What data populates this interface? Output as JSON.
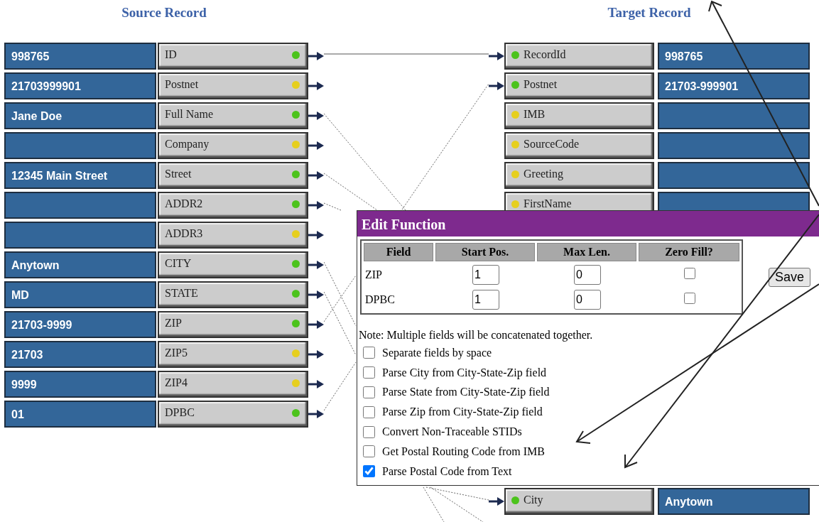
{
  "source": {
    "title": "Source Record",
    "rows": [
      {
        "value": "998765",
        "field": "ID",
        "color": "#4cc31c"
      },
      {
        "value": "21703999901",
        "field": "Postnet",
        "color": "#e6cf1e"
      },
      {
        "value": "Jane Doe",
        "field": "Full Name",
        "color": "#4cc31c"
      },
      {
        "field": "Company",
        "color": "#e6cf1e"
      },
      {
        "value": "12345 Main Street",
        "field": "Street",
        "color": "#4cc31c"
      },
      {
        "field": "ADDR2",
        "color": "#4cc31c"
      },
      {
        "field": "ADDR3",
        "color": "#e6cf1e"
      },
      {
        "value": "Anytown",
        "field": "CITY",
        "color": "#4cc31c"
      },
      {
        "value": "MD",
        "field": "STATE",
        "color": "#4cc31c"
      },
      {
        "value": "21703-9999",
        "field": "ZIP",
        "color": "#4cc31c"
      },
      {
        "value": "21703",
        "field": "ZIP5",
        "color": "#e6cf1e"
      },
      {
        "value": "9999",
        "field": "ZIP4",
        "color": "#e6cf1e"
      },
      {
        "value": "01",
        "field": "DPBC",
        "color": "#4cc31c"
      }
    ]
  },
  "target": {
    "title": "Target Record",
    "rows": [
      {
        "field": "RecordId",
        "value": "998765",
        "color": "#4cc31c",
        "mapped": true
      },
      {
        "field": "Postnet",
        "value": "21703-999901",
        "color": "#4cc31c",
        "mapped": true
      },
      {
        "field": "IMB",
        "color": "#e6cf1e",
        "mapped": false
      },
      {
        "field": "SourceCode",
        "color": "#e6cf1e",
        "mapped": false
      },
      {
        "field": "Greeting",
        "color": "#e6cf1e",
        "mapped": false
      },
      {
        "field": "FirstName",
        "color": "#e6cf1e",
        "mapped": false
      },
      {
        "field": "City",
        "value": "Anytown",
        "color": "#4cc31c",
        "mapped": true
      }
    ]
  },
  "dialog": {
    "title": "Edit Function",
    "columns": [
      "Field",
      "Start Pos.",
      "Max Len.",
      "Zero Fill?"
    ],
    "rows": [
      {
        "field": "ZIP",
        "start": "1",
        "max_len": "0",
        "zero_fill": false
      },
      {
        "field": "DPBC",
        "start": "1",
        "max_len": "0",
        "zero_fill": false
      }
    ],
    "save": "Save",
    "note": "Note: Multiple fields will be concatenated together.",
    "options": [
      {
        "label": "Separate fields by space",
        "checked": false
      },
      {
        "label": "Parse City from City-State-Zip field",
        "checked": false
      },
      {
        "label": "Parse State from City-State-Zip field",
        "checked": false
      },
      {
        "label": "Parse Zip from City-State-Zip field",
        "checked": false
      },
      {
        "label": "Convert Non-Traceable STIDs",
        "checked": false
      },
      {
        "label": "Get Postal Routing Code from IMB",
        "checked": false
      },
      {
        "label": "Parse Postal Code from Text",
        "checked": true
      }
    ]
  }
}
